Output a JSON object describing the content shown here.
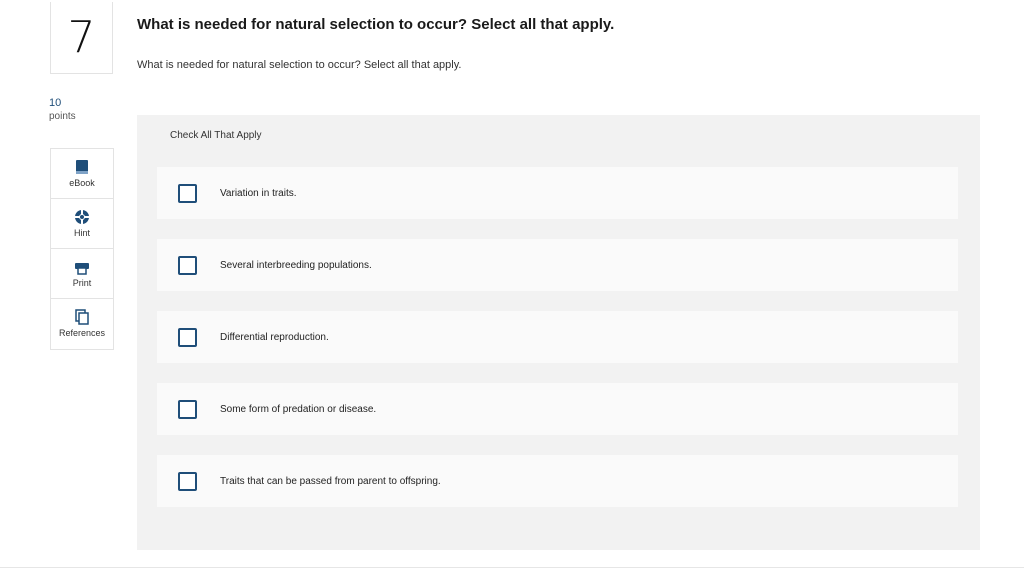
{
  "question": {
    "number": "7",
    "points_value": "10",
    "points_label": "points",
    "title": "What is needed for natural selection to occur? Select all that apply.",
    "text": "What is needed for natural selection to occur? Select all that apply."
  },
  "tools": [
    {
      "label": "eBook",
      "icon": "book-icon"
    },
    {
      "label": "Hint",
      "icon": "lifebuoy-icon"
    },
    {
      "label": "Print",
      "icon": "printer-icon"
    },
    {
      "label": "References",
      "icon": "copy-icon"
    }
  ],
  "answer_panel": {
    "header": "Check All That Apply",
    "options": [
      {
        "label": "Variation in traits.",
        "checked": false
      },
      {
        "label": "Several interbreeding populations.",
        "checked": false
      },
      {
        "label": "Differential reproduction.",
        "checked": false
      },
      {
        "label": "Some form of predation or disease.",
        "checked": false
      },
      {
        "label": "Traits that can be passed from parent to offspring.",
        "checked": false
      }
    ]
  },
  "colors": {
    "accent": "#1f4e79",
    "panel_bg": "#f2f2f2",
    "option_bg": "#fafafa"
  }
}
